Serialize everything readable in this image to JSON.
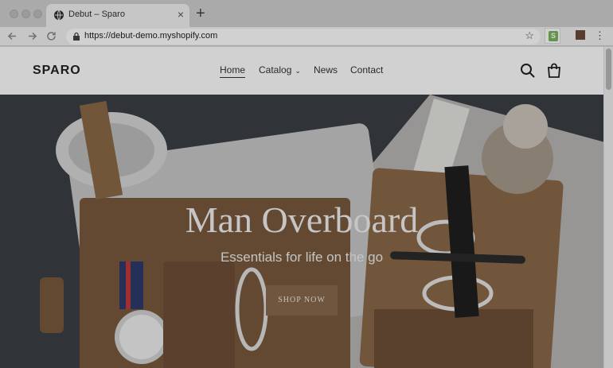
{
  "browser": {
    "tab_title": "Debut – Sparo",
    "url": "https://debut-demo.myshopify.com",
    "new_tab_label": "+",
    "close_tab_label": "×"
  },
  "site": {
    "logo": "SPARO",
    "nav": [
      {
        "label": "Home"
      },
      {
        "label": "Catalog"
      },
      {
        "label": "News"
      },
      {
        "label": "Contact"
      }
    ],
    "icons": [
      "search-icon",
      "cart-icon"
    ]
  },
  "hero": {
    "title": "Man Overboard",
    "subtitle": "Essentials for life on the go",
    "cta": "SHOP NOW"
  },
  "colors": {
    "cta_bg": "#8a6a4d",
    "hero_bg": "#3a3e44",
    "shopify_green": "#7ab55c"
  }
}
